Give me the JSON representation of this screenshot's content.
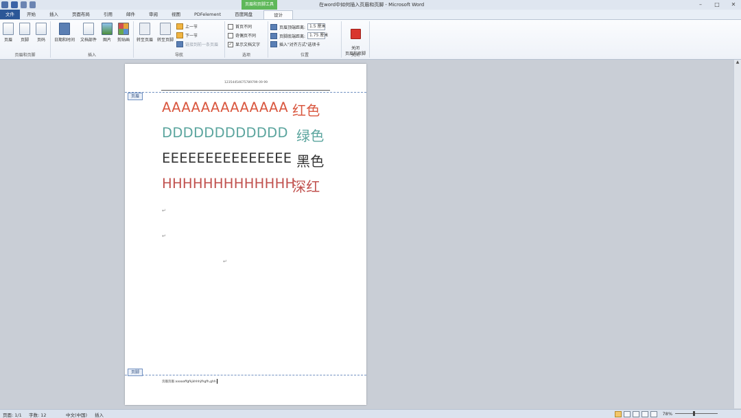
{
  "window": {
    "title": "在word中如何插入页眉和页脚 - Microsoft Word",
    "context_tab_header": "页眉和页脚工具",
    "controls": [
      "–",
      "□",
      "✕"
    ]
  },
  "tabs": [
    {
      "label": "文件"
    },
    {
      "label": "开始"
    },
    {
      "label": "插入"
    },
    {
      "label": "页面布局"
    },
    {
      "label": "引用"
    },
    {
      "label": "邮件"
    },
    {
      "label": "审阅"
    },
    {
      "label": "视图"
    },
    {
      "label": "PDFelement"
    },
    {
      "label": "百度网盘"
    },
    {
      "label": "设计"
    }
  ],
  "ribbon": {
    "hf_group": {
      "label": "页眉和页脚",
      "buttons": [
        "页眉",
        "页脚",
        "页码"
      ]
    },
    "insert_group": {
      "label": "插入",
      "buttons": [
        "日期和时间",
        "文档部件",
        "图片",
        "剪贴画"
      ]
    },
    "nav_group": {
      "label": "导航",
      "buttons": [
        "转至页眉",
        "转至页脚"
      ],
      "prev": "上一节",
      "next": "下一节",
      "link": "链接到前一条页眉"
    },
    "options_group": {
      "label": "选项",
      "opt1": "首页不同",
      "opt2": "奇偶页不同",
      "opt3": "显示文档文字",
      "opt3_checked": "✓"
    },
    "position_group": {
      "label": "位置",
      "header_dist_label": "页眉顶端距离:",
      "header_dist": "1.5 厘米",
      "footer_dist_label": "页脚底端距离:",
      "footer_dist": "1.75 厘米",
      "align_tab": "插入\"对齐方式\"选项卡"
    },
    "close_group": {
      "label": "关闭",
      "button": "关闭\n页眉和页脚"
    }
  },
  "document": {
    "header_text": "12354454675789799 09 99",
    "header_tag": "页眉",
    "footer_tag": "页脚",
    "footer_text": "页眉页眉 aaaaaffgfkjkhhhjfhgfh,ghh",
    "lines": [
      {
        "latin": "AAAAAAAAAAAAA",
        "zh": "红色",
        "color": "#d9573f"
      },
      {
        "latin": "DDDDDDDDDDDD",
        "zh": "绿色",
        "color": "#5ba59e"
      },
      {
        "latin": "EEEEEEEEEEEEEEE",
        "zh": "黑色",
        "color": "#333333"
      },
      {
        "latin": "HHHHHHHHHHHHH",
        "zh": "深红",
        "color": "#c0504d"
      }
    ],
    "para_mark": "↵"
  },
  "statusbar": {
    "page": "页面: 1/1",
    "words": "字数: 12",
    "lang": "中文(中国)",
    "mode": "插入",
    "zoom": "78%"
  }
}
